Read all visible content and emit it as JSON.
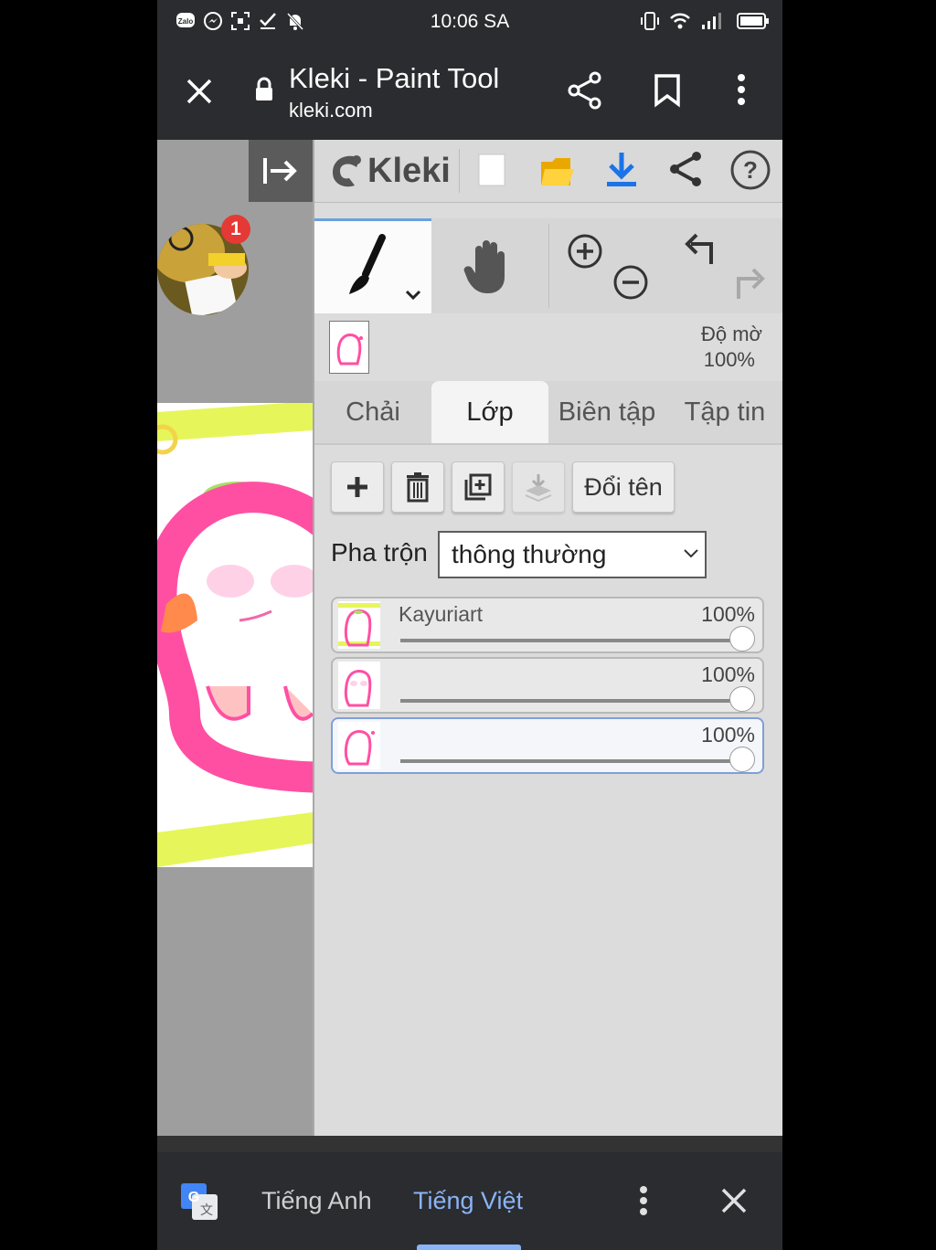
{
  "status_bar": {
    "time": "10:06 SA",
    "left_icons": [
      "zalo-icon",
      "messenger-icon",
      "screenshot-icon",
      "check-icon",
      "bell-off-icon"
    ],
    "right_icons": [
      "vibrate-icon",
      "wifi-icon",
      "signal-icon",
      "battery-icon"
    ]
  },
  "browser": {
    "title": "Kleki - Paint Tool",
    "url": "kleki.com"
  },
  "floating_bubble": {
    "badge": "1"
  },
  "kleki": {
    "logo": "Kleki",
    "opacity_label": "Độ mờ",
    "opacity_value": "100%",
    "tabs": [
      {
        "label": "Chải",
        "active": false
      },
      {
        "label": "Lớp",
        "active": true
      },
      {
        "label": "Biên tập",
        "active": false
      },
      {
        "label": "Tập tin",
        "active": false
      }
    ],
    "layer_buttons": {
      "rename_label": "Đổi tên"
    },
    "blend": {
      "label": "Pha trộn",
      "value": "thông thường"
    },
    "layers": [
      {
        "name": "Kayuriart",
        "opacity": "100%",
        "opacity_value": 1.0,
        "selected": false
      },
      {
        "name": "",
        "opacity": "100%",
        "opacity_value": 1.0,
        "selected": false
      },
      {
        "name": "",
        "opacity": "100%",
        "opacity_value": 1.0,
        "selected": true
      }
    ]
  },
  "translate_bar": {
    "source_lang": "Tiếng Anh",
    "target_lang": "Tiếng Việt"
  },
  "colors": {
    "accent_blue": "#1a73e8",
    "translate_active": "#8ab4f8",
    "notification_red": "#e53935",
    "character_pink": "#ff4fa3",
    "stripe_lime": "#e6f55a"
  }
}
